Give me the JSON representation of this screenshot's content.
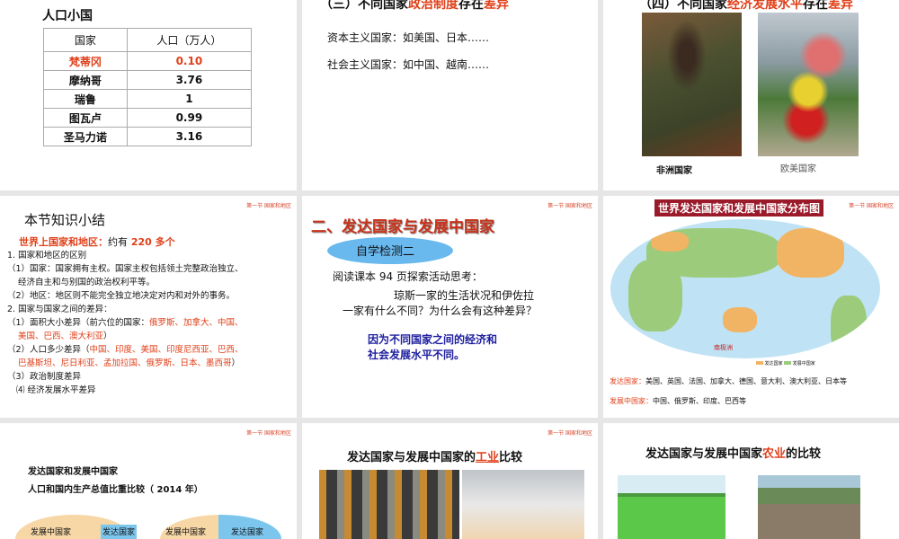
{
  "section_tag": "第一节 国家和地区",
  "slide1": {
    "title": "人口小国",
    "headers": [
      "国家",
      "人口（万人）"
    ],
    "rows": [
      [
        "梵蒂冈",
        "0.10"
      ],
      [
        "摩纳哥",
        "3.76"
      ],
      [
        "瑞鲁",
        "1"
      ],
      [
        "图瓦卢",
        "0.99"
      ],
      [
        "圣马力诺",
        "3.16"
      ]
    ]
  },
  "slide2": {
    "title_pre": "（三）不同国家",
    "title_red1": "政治制度",
    "title_mid": "存在",
    "title_red2": "差异",
    "line1": "资本主义国家：如美国、日本……",
    "line2": "社会主义国家：如中国、越南……"
  },
  "slide3": {
    "title_pre": "（四）不同国家",
    "title_red1": "经济发展水平",
    "title_mid": "存在",
    "title_red2": "差异",
    "caption1": "非洲国家",
    "caption2": "欧美国家"
  },
  "slide4": {
    "title": "本节知识小结",
    "l0_red": "世界上国家和地区：",
    "l0_b": "约有",
    "l0_red2": "220 多个",
    "l1": "1. 国家和地区的区别",
    "l2": "（1）国家：国家拥有主权。国家主权包括领土完整政治独立、",
    "l3": "经济自主和与别国的政治权利平等。",
    "l4": "（2）地区：地区则不能完全独立地决定对内和对外的事务。",
    "l5": "2. 国家与国家之间的差异：",
    "l6": "（1）面积大小差异（前六位的国家：",
    "l6_red": "俄罗斯、加拿大、中国、",
    "l7_red": "美国、巴西、澳大利亚",
    "l7": "）",
    "l8": "（2）人口多少差异（",
    "l8_red": "中国、印度、美国、印度尼西亚、巴西、",
    "l9_red": "巴基斯坦、尼日利亚、孟加拉国、俄罗斯、日本、墨西哥",
    "l9": "）",
    "l10": "（3）政治制度差异",
    "l11": "⑷ 经济发展水平差异"
  },
  "slide5": {
    "title": "二、发达国家与发展中国家",
    "cloud": "自学检测二",
    "q1": "阅读课本 94 页探索活动思考：",
    "q2": "琼斯一家的生活状况和伊佐拉",
    "q3": "一家有什么不同？为什么会有这种差异？",
    "a1": "因为不同国家之间的经济和",
    "a2": "社会发展水平不同。"
  },
  "slide6": {
    "title": "世界发达国家和发展中国家分布图",
    "legend1": "发达国家",
    "legend2": "发展中国家",
    "dev_label": "发达国家：",
    "dev_list": "美国、英国、法国、加拿大、德国、意大利、澳大利亚、日本等",
    "ing_label": "发展中国家：",
    "ing_list": "中国、俄罗斯、印度、巴西等",
    "antarctica": "南极洲"
  },
  "slide7": {
    "t1": "发达国家和发展中国家",
    "t2": "人口和国内生产总值比重比较（ 2014 年）",
    "p1a": "发展中国家",
    "p1b": "发达国家",
    "p2a": "发展中国家",
    "p2b": "发达国家"
  },
  "slide8": {
    "pre": "发达国家与发展中国家的",
    "red": "工业",
    "post": "比较"
  },
  "slide9": {
    "pre": "发达国家与发展中国家",
    "red": "农业",
    "post": "的比较"
  }
}
